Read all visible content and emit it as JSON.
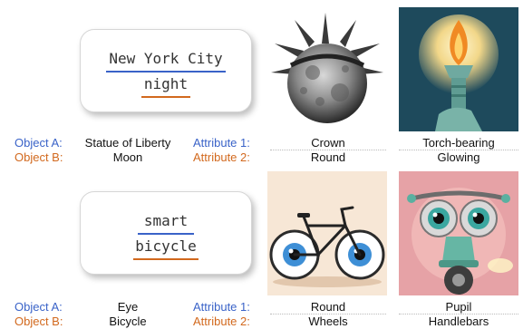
{
  "colors": {
    "object_a": "#3a63c8",
    "object_b": "#d2691e"
  },
  "panels": [
    {
      "prompt": {
        "word_a": "New York City",
        "word_b": "night"
      },
      "labels": {
        "object_a": "Object A:",
        "object_b": "Object B:",
        "attribute_1": "Attribute 1:",
        "attribute_2": "Attribute 2:"
      },
      "object_a": "Statue of Liberty",
      "object_b": "Moon",
      "attributes": [
        {
          "row1": "Crown",
          "row2": "Round"
        },
        {
          "row1": "Torch-bearing",
          "row2": "Glowing"
        }
      ]
    },
    {
      "prompt": {
        "word_a": "smart",
        "word_b": "bicycle"
      },
      "labels": {
        "object_a": "Object A:",
        "object_b": "Object B:",
        "attribute_1": "Attribute 1:",
        "attribute_2": "Attribute 2:"
      },
      "object_a": "Eye",
      "object_b": "Bicycle",
      "attributes": [
        {
          "row1": "Round",
          "row2": "Wheels"
        },
        {
          "row1": "Pupil",
          "row2": "Handlebars"
        }
      ]
    }
  ]
}
